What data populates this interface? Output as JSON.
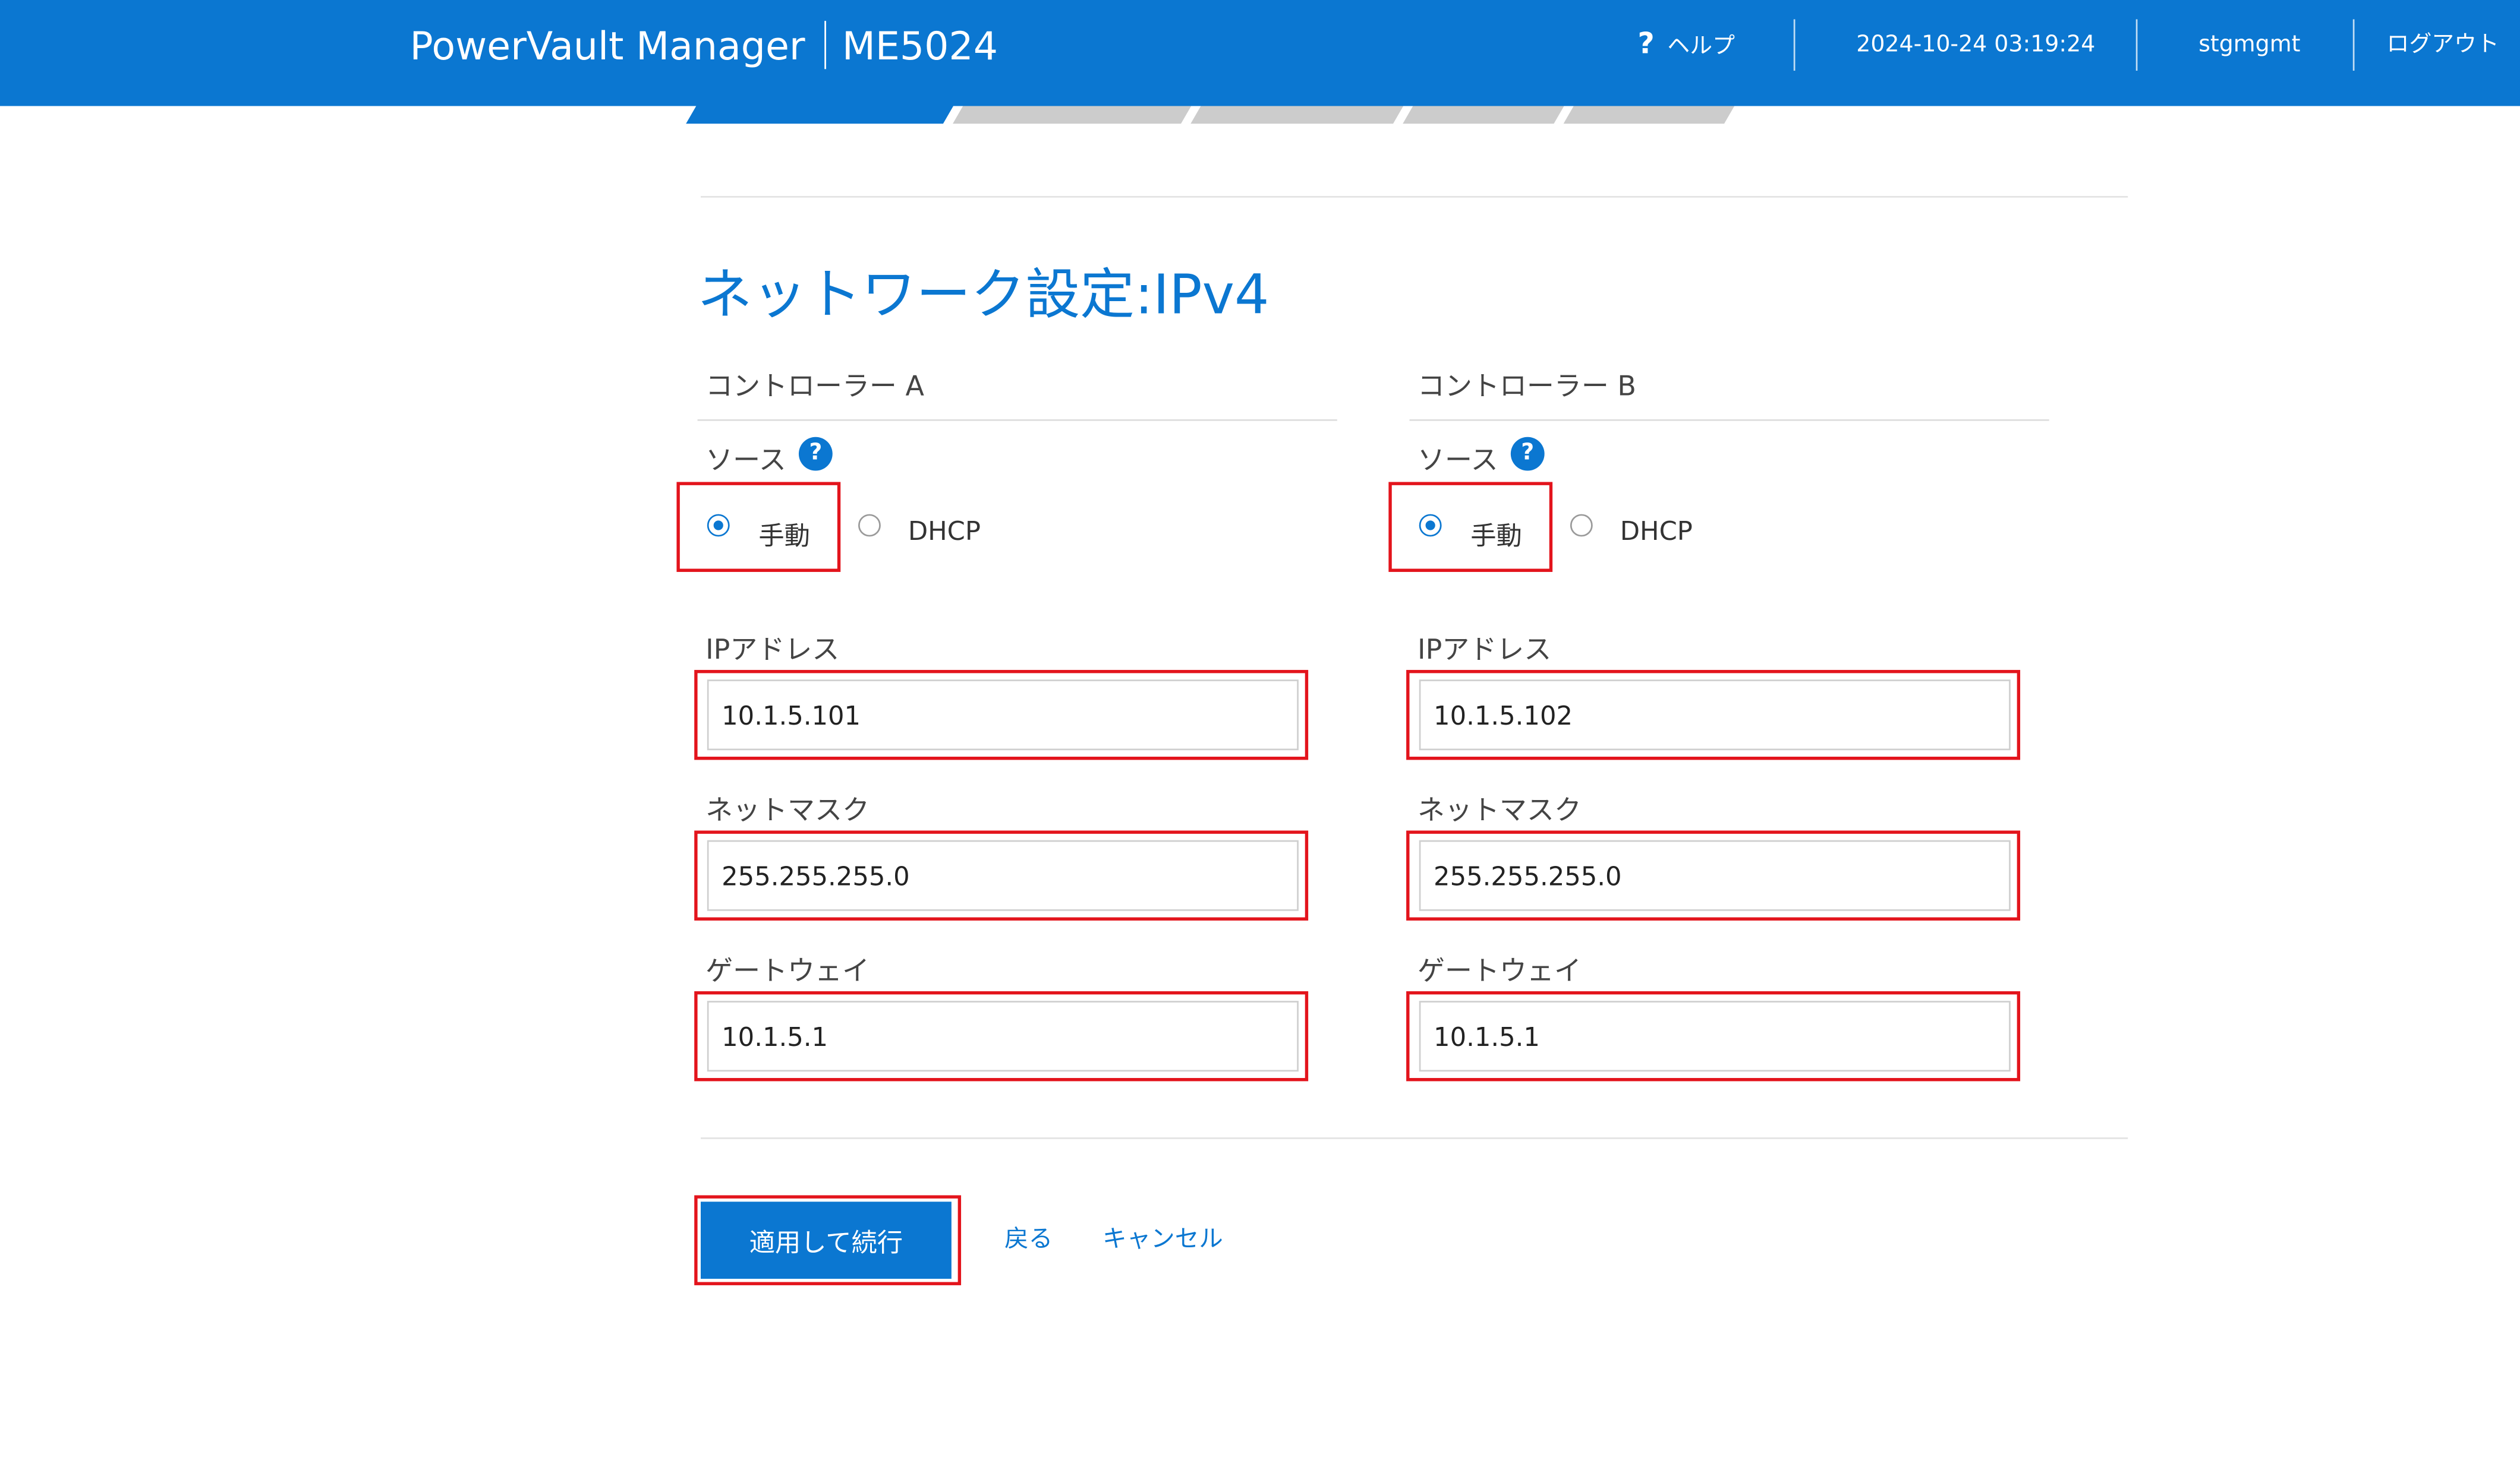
{
  "header": {
    "product": "PowerVault Manager",
    "model": "ME5024",
    "help_label": "ヘルプ",
    "help_glyph": "?",
    "datetime": "2024-10-24 03:19:24",
    "user": "stgmgmt",
    "logout_label": "ログアウト",
    "bg_color": "#0b77d1"
  },
  "wizard": {
    "steps": [
      {
        "state": "active",
        "color": "#0b77d1"
      },
      {
        "state": "pending",
        "color": "#cccccc"
      },
      {
        "state": "pending",
        "color": "#cccccc"
      },
      {
        "state": "pending",
        "color": "#cccccc"
      },
      {
        "state": "pending",
        "color": "#cccccc"
      }
    ]
  },
  "page": {
    "title": "ネットワーク設定:IPv4"
  },
  "controllers": [
    {
      "label": "コントローラー A",
      "source_label": "ソース",
      "help_glyph": "?",
      "options": [
        {
          "label": "手動",
          "selected": true
        },
        {
          "label": "DHCP",
          "selected": false
        }
      ],
      "ip_label": "IPアドレス",
      "ip_value": "10.1.5.101",
      "netmask_label": "ネットマスク",
      "netmask_value": "255.255.255.0",
      "gateway_label": "ゲートウェイ",
      "gateway_value": "10.1.5.1"
    },
    {
      "label": "コントローラー B",
      "source_label": "ソース",
      "help_glyph": "?",
      "options": [
        {
          "label": "手動",
          "selected": true
        },
        {
          "label": "DHCP",
          "selected": false
        }
      ],
      "ip_label": "IPアドレス",
      "ip_value": "10.1.5.102",
      "netmask_label": "ネットマスク",
      "netmask_value": "255.255.255.0",
      "gateway_label": "ゲートウェイ",
      "gateway_value": "10.1.5.1"
    }
  ],
  "actions": {
    "apply_label": "適用して続行",
    "back_label": "戻る",
    "cancel_label": "キャンセル"
  },
  "highlight_color": "#e3141c"
}
